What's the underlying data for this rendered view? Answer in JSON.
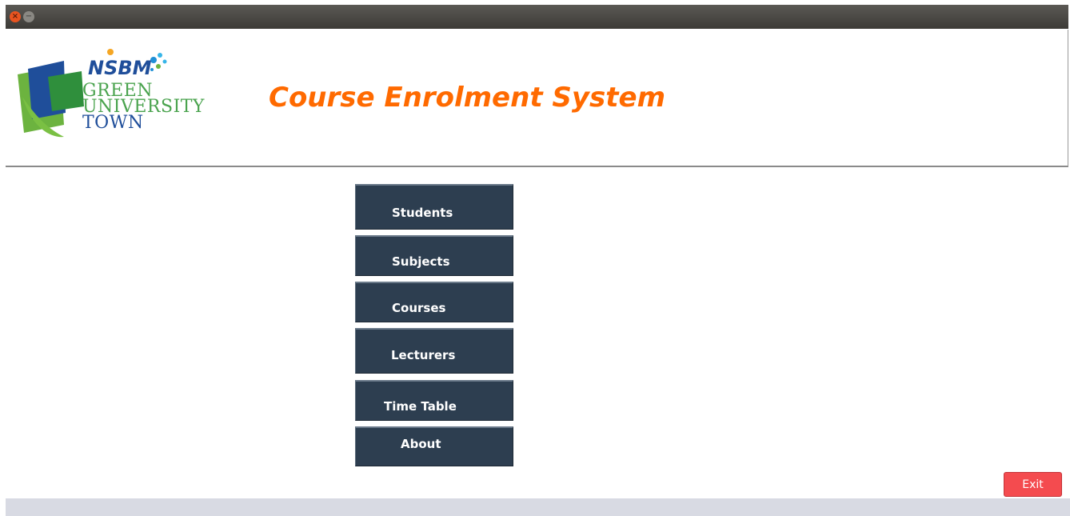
{
  "window": {
    "close_icon": "close-icon",
    "minimize_icon": "minimize-icon"
  },
  "header": {
    "logo": {
      "brand": "NSBM",
      "line1": "GREEN",
      "line2": "UNIVERSITY",
      "line3": "TOWN"
    },
    "title": "Course Enrolment System",
    "title_color": "#ff6a00"
  },
  "menu": {
    "items": [
      {
        "label": "Students"
      },
      {
        "label": "Subjects"
      },
      {
        "label": "Courses"
      },
      {
        "label": "Lecturers"
      },
      {
        "label": "Time Table"
      },
      {
        "label": "About"
      }
    ],
    "button_color": "#2d3e50"
  },
  "footer": {
    "exit_label": "Exit",
    "exit_color": "#f44b4f"
  }
}
